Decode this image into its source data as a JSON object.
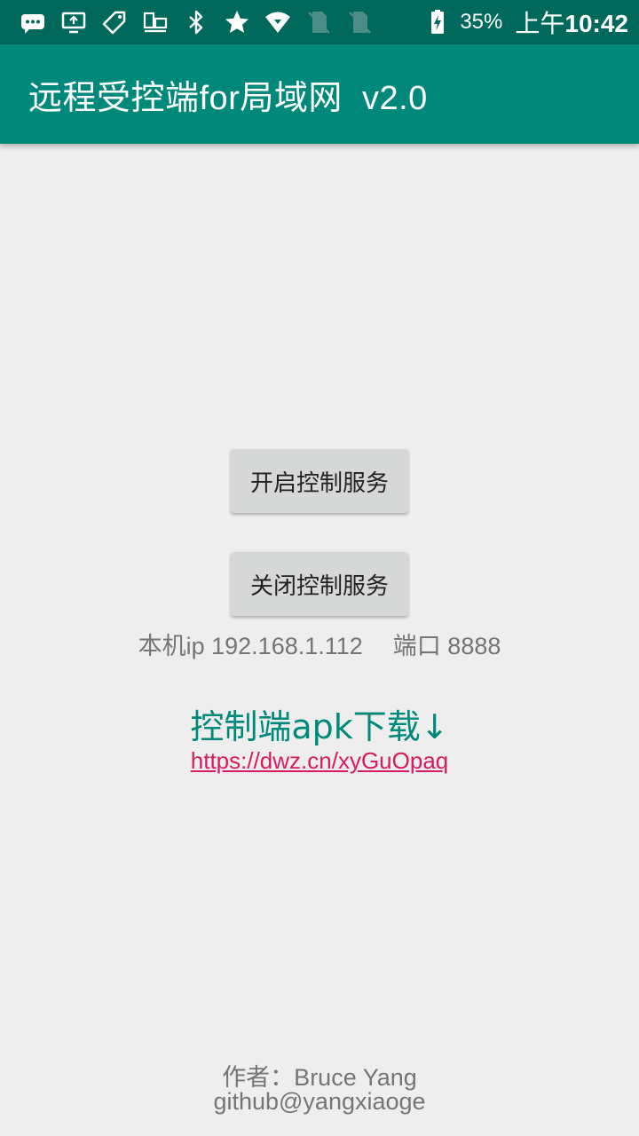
{
  "status_bar": {
    "battery_percent": "35%",
    "time_prefix": "上午",
    "time": "10:42",
    "icons": [
      "chat-bubble-icon",
      "cast-icon",
      "tag-icon",
      "devices-icon",
      "bluetooth-icon",
      "star-icon",
      "wifi-icon",
      "no-sim-icon",
      "no-sim-icon",
      "battery-charging-icon"
    ]
  },
  "app_bar": {
    "title": "远程受控端for局域网  v2.0"
  },
  "main": {
    "start_button": "开启控制服务",
    "stop_button": "关闭控制服务",
    "ip_label": "本机ip 192.168.1.112",
    "port_label": "端口 8888",
    "download_title": "控制端apk下载↓",
    "download_link": "https://dwz.cn/xyGuOpaq"
  },
  "footer": {
    "author": "作者：Bruce Yang",
    "github": "github@yangxiaoge"
  },
  "colors": {
    "status_bar": "#00695c",
    "app_bar": "#00897b",
    "background": "#eeeeee",
    "accent": "#00897b",
    "link": "#d81b60",
    "button": "#d6d7d7"
  }
}
